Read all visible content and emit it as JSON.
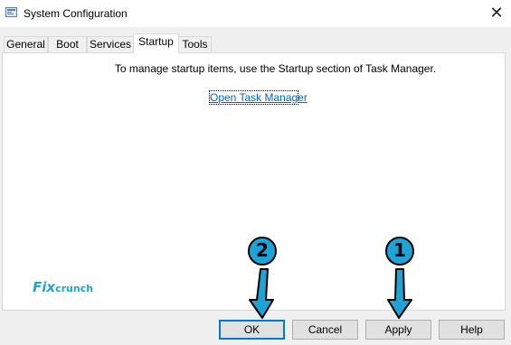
{
  "window": {
    "title": "System Configuration",
    "close_glyph": "✕"
  },
  "tabs": [
    {
      "label": "General"
    },
    {
      "label": "Boot"
    },
    {
      "label": "Services"
    },
    {
      "label": "Startup",
      "active": true
    },
    {
      "label": "Tools"
    }
  ],
  "startup": {
    "message": "To manage startup items, use the Startup section of Task Manager.",
    "link_label": "Open Task Manager"
  },
  "watermark": {
    "part1": "Fix",
    "part2": "crunch"
  },
  "buttons": {
    "ok": "OK",
    "cancel": "Cancel",
    "apply": "Apply",
    "help": "Help"
  },
  "annotations": {
    "step1": "1",
    "step2": "2",
    "color": "#1fa3d7"
  },
  "icons": [
    "app-icon",
    "close-icon",
    "arrow-down-icon"
  ]
}
